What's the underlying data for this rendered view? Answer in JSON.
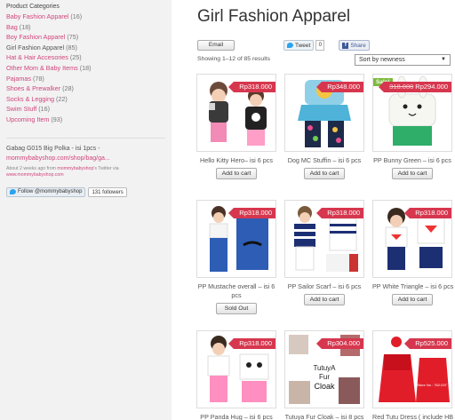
{
  "sidebar": {
    "title": "Product Categories",
    "categories": [
      {
        "name": "Baby Fashion Apparel",
        "count": "(16)"
      },
      {
        "name": "Bag",
        "count": "(18)"
      },
      {
        "name": "Boy Fashion Apparel",
        "count": "(75)"
      },
      {
        "name": "Girl Fashion Apparel",
        "count": "(85)"
      },
      {
        "name": "Hat & Hair Accesories",
        "count": "(25)"
      },
      {
        "name": "Other Mom & Baby Items",
        "count": "(18)"
      },
      {
        "name": "Pajamas",
        "count": "(78)"
      },
      {
        "name": "Shoes & Prewalker",
        "count": "(28)"
      },
      {
        "name": "Socks & Legging",
        "count": "(22)"
      },
      {
        "name": "Swim Stuff",
        "count": "(16)"
      },
      {
        "name": "Upcoming Item",
        "count": "(93)"
      }
    ],
    "tweet": {
      "text": "Gabag G015 Big Polka - isi 1pcs -",
      "link": "mommybabyshop.com/shop/bag/ga...",
      "meta_prefix": "About 2 weeks ago from ",
      "meta_user": "mommybabyshop",
      "meta_mid": "'s Twitter via ",
      "meta_source": "www.mommybabyshop.com"
    },
    "follow": {
      "label": "Follow @mommybabyshop",
      "followers": "131 followers"
    }
  },
  "main": {
    "title": "Girl Fashion Apparel",
    "share": {
      "email": "Email",
      "tweet": "Tweet",
      "tweet_count": "0",
      "facebook": "Share"
    },
    "result_count": "Showing 1–12 of 85 results",
    "orderby": "Sort by newness",
    "products": [
      {
        "name": "Hello Kitty Hero– isi 6 pcs",
        "price": "Rp318.000",
        "button": "Add to cart"
      },
      {
        "name": "Dog MC Stuffin – isi 6 pcs",
        "price": "Rp348.000",
        "button": "Add to cart"
      },
      {
        "name": "PP Bunny Green – isi 6 pcs",
        "old_price": "318.000",
        "price": "Rp294.000",
        "sale": "Sale!",
        "button": "Add to cart"
      },
      {
        "name": "PP Mustache overall – isi 6 pcs",
        "price": "Rp318.000",
        "button": "Sold Out"
      },
      {
        "name": "PP Sailor Scarf – isi 6 pcs",
        "price": "Rp318.000",
        "button": "Add to cart"
      },
      {
        "name": "PP White Triangle – isi 6 pcs",
        "price": "Rp318.000",
        "button": "Add to cart"
      },
      {
        "name": "PP Panda Hug – isi 6 pcs",
        "price": "Rp318.000"
      },
      {
        "name": "Tutuya Fur Cloak – isi 8 pcs",
        "price": "Rp304.000"
      },
      {
        "name": "Red Tutu Dress ( include HB",
        "price": "Rp525.000"
      }
    ],
    "image_texts": {
      "fur_cloak": [
        "TutuyA",
        "Fur",
        "Cloak"
      ],
      "red_dress_store": "Store No : 762.037"
    }
  },
  "colors": {
    "accent": "#d0457c",
    "price": "#d6374e",
    "sale": "#7dba3c",
    "sidebar_bg": "#f2f2f2"
  }
}
